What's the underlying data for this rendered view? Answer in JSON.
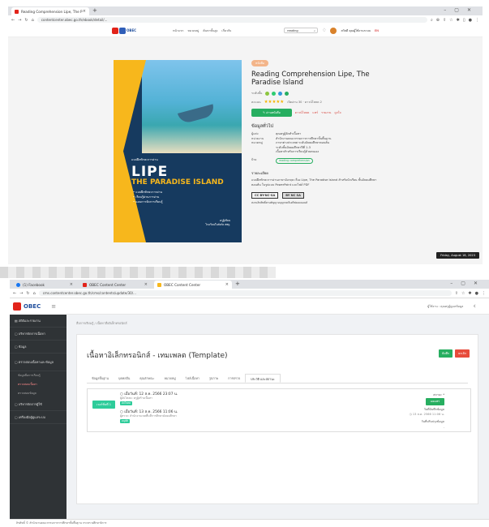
{
  "win1": {
    "tabs": [
      {
        "label": "Reading Comprehension Lipe, The P"
      }
    ],
    "url": "contentcenter.obec.go.th/ebook/detail/...",
    "site": {
      "logo_text": "OBEC",
      "nav": [
        "หน้าแรก",
        "หมวดหมู่",
        "ค้นหาขั้นสูง",
        "เกี่ยวกับ"
      ],
      "search_value": "reading",
      "user_label": "สวัสดี คุณผู้ใช้งานระบบ",
      "lang": "EN"
    },
    "cover": {
      "sub": "แบบฝึกทักษะการอ่าน",
      "title_line1": "LIPE",
      "title_line2": "THE PARADISE ISLAND",
      "bullets": [
        "• แบบฝึกทักษะการอ่าน",
        "• เรียนรู้ผ่านการอ่าน",
        "• แผนการจัดการเรียนรู้"
      ],
      "publisher": [
        "ครูผู้เขียน",
        "โรงเรียนในสังกัด สพฐ."
      ]
    },
    "book": {
      "category_pill": "หนังสือ",
      "title": "Reading Comprehension Lipe, The Paradise Island",
      "level_label": "ระดับชั้น",
      "rating_label": "คะแนน",
      "stars": "★★★★★",
      "views": "เปิดอ่าน 30 · ดาวน์โหลด 2",
      "read_btn": "อ่านหนังสือ",
      "links": [
        "ดาวน์โหลด",
        "แชร์",
        "รายงาน",
        "ถูกใจ"
      ],
      "general_heading": "ข้อมูลทั่วไป",
      "fields": [
        {
          "k": "ผู้แต่ง",
          "v": "คุณครูผู้จัดทำเนื้อหา"
        },
        {
          "k": "หน่วยงาน",
          "v": "สำนักงานคณะกรรมการการศึกษาขั้นพื้นฐาน"
        },
        {
          "k": "หมวดหมู่",
          "v": "ภาษาต่างประเทศ ระดับมัธยมศึกษาตอนต้น"
        },
        {
          "k": "",
          "v": "ระดับชั้นมัธยมศึกษาปีที่ 1-3"
        },
        {
          "k": "",
          "v": "เนื้อหาสำหรับการเรียนรู้ด้วยตนเอง"
        },
        {
          "k": "ป้าย",
          "v": ""
        }
      ],
      "tag_chip": "reading comprehension",
      "desc_heading": "รายละเอียด",
      "desc": "แบบฝึกทักษะการอ่านภาษาอังกฤษ เรื่อง Lipe, The Paradise Island สำหรับนักเรียน ชั้นมัธยมศึกษาตอนต้น ในรูปแบบ PowerPoint และไฟล์ PDF",
      "cc_label": "CC BY-NC-SA",
      "cc_note": "สงวนลิขสิทธิ์ตามสัญญาอนุญาตครีเอทีฟคอมมอนส์",
      "cc_badge": "BY NC SA"
    },
    "tooltip": "Friday, August 18, 2023"
  },
  "win2": {
    "tabs": [
      {
        "label": "(1) Facebook"
      },
      {
        "label": "OBEC Content Center"
      },
      {
        "label": "OBEC Content Center"
      }
    ],
    "url": "cms.contentcenter.obec.go.th/cms/contents/update/30/...",
    "logo_text": "OBEC",
    "sidebar": [
      {
        "label": "สถิติและรายงาน"
      },
      {
        "label": "บริหารจัดการเนื้อหา"
      },
      {
        "label": "ข้อมูล"
      },
      {
        "label": "ตรวจสอบเนื้อหาและข้อมูล"
      }
    ],
    "sidebar_sub": [
      "ข้อมูลสื่อการเรียนรู้",
      "ตรวจสอบเนื้อหา",
      "ตรวจสอบข้อมูล"
    ],
    "sidebar_more": [
      {
        "label": "บริหารจัดการผู้ใช้"
      },
      {
        "label": "เครื่องมือผู้ดูแลระบบ"
      }
    ],
    "top_user": "ผู้ใช้งาน : คุณครูผู้ดูแลข้อมูล",
    "breadcrumb": "สื่อการเรียนรู้ / เนื้อหาสื่ออิเล็กทรอนิกส์",
    "card_title": "เนื้อหาอิเล็กทรอนิกส์ - เทมเพลต (Template)",
    "save_btn": "บันทึก",
    "cancel_btn": "ยกเลิก",
    "tabs_row": [
      "ข้อมูลพื้นฐาน",
      "บุคคลอื่น",
      "คุณลักษณะ",
      "หมวดหมู่",
      "ไฟล์เนื้อหา",
      "รูปภาพ",
      "การตรวจ",
      "ประวัติ และสถานะ"
    ],
    "active_tab_index": 7,
    "version_btn": "เวอร์ชั่นที่ 1",
    "entries": [
      {
        "ts": "เมื่อวันที่: 12 ส.ค. 2566 23:07 น.",
        "who": "ผู้อัปโหลด: ครูผู้สร้างเนื้อหา",
        "tag": "อัปโหลด"
      },
      {
        "ts": "เมื่อวันที่: 13 ส.ค. 2566 11:06 น.",
        "who": "ผู้ตรวจ: สำนักงานเขตพื้นที่การศึกษามัธยมศึกษา",
        "tag": "อนุมัติ"
      }
    ],
    "status_label": "สถานะ *",
    "status_btn": "เผยแพร่",
    "pub_date_label": "วันที่บันทึกข้อมูล",
    "pub_date_value": "◷ 13 ส.ค. 2566 11:06 น.",
    "last_update_label": "วันที่ปรับปรุงข้อมูล",
    "last_update_value": "-",
    "footer": "ลิขสิทธิ์ © สำนักงานคณะกรรมการการศึกษาขั้นพื้นฐาน กระทรวงศึกษาธิการ"
  }
}
